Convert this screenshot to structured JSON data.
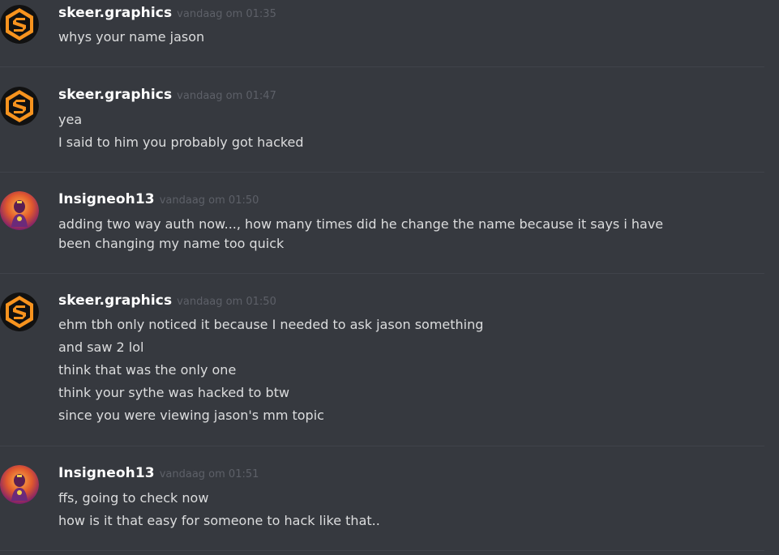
{
  "messages": [
    {
      "author": "skeer.graphics",
      "timestamp": "vandaag om 01:35",
      "avatar_icon": "skeer-logo-icon",
      "lines": [
        "whys your name jason"
      ]
    },
    {
      "author": "skeer.graphics",
      "timestamp": "vandaag om 01:47",
      "avatar_icon": "skeer-logo-icon",
      "lines": [
        "yea",
        "I said to him you probably got hacked"
      ]
    },
    {
      "author": "Insigneoh13",
      "timestamp": "vandaag om 01:50",
      "avatar_icon": "character-portrait-icon",
      "lines": [
        "adding two way auth now..., how many times did he change the name because it says i have been changing my name too quick"
      ]
    },
    {
      "author": "skeer.graphics",
      "timestamp": "vandaag om 01:50",
      "avatar_icon": "skeer-logo-icon",
      "lines": [
        "ehm tbh only noticed it because I needed to ask jason something",
        "and saw 2 lol",
        "think that was the only one",
        "think your sythe was hacked to btw",
        "since you were viewing jason's mm topic"
      ]
    },
    {
      "author": "Insigneoh13",
      "timestamp": "vandaag om 01:51",
      "avatar_icon": "character-portrait-icon",
      "lines": [
        "ffs, going to check now",
        "how is it that easy for someone to hack like that.."
      ]
    }
  ],
  "colors": {
    "background": "#36393f",
    "author": "#ffffff",
    "text": "#dcddde",
    "timestamp": "#5d6068",
    "logo_orange": "#f7931e"
  }
}
